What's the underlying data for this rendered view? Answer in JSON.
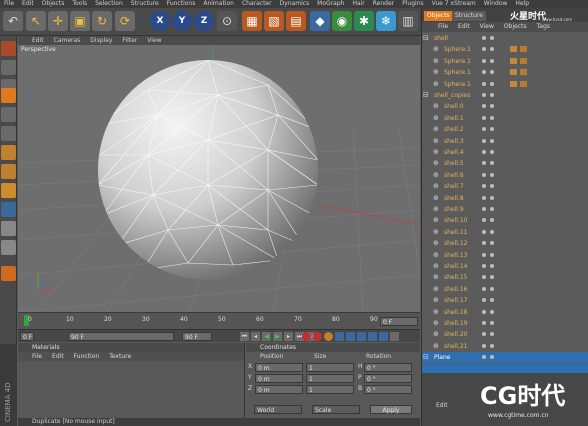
{
  "menubar": {
    "items": [
      "File",
      "Edit",
      "Objects",
      "Tools",
      "Selection",
      "Structure",
      "Functions",
      "Animation",
      "Character",
      "Dynamics",
      "MoGraph",
      "Hair",
      "Render",
      "Plugins",
      "Vue 7 xStream",
      "Window",
      "Help"
    ]
  },
  "toolbar": {
    "xyz": [
      "X",
      "Y",
      "Z"
    ]
  },
  "viewport": {
    "menu": [
      "Edit",
      "Cameras",
      "Display",
      "Filter",
      "View"
    ],
    "label": "Perspective"
  },
  "timeline": {
    "ticks": [
      "0",
      "10",
      "20",
      "30",
      "40",
      "50",
      "60",
      "70",
      "80",
      "90"
    ],
    "end_label": "0 F"
  },
  "transport": {
    "start": "0 F",
    "field2": "90 F",
    "field3": "90 F"
  },
  "materials": {
    "title": "Materials",
    "menu": [
      "File",
      "Edit",
      "Function",
      "Texture"
    ]
  },
  "coordinates": {
    "title": "Coordinates",
    "columns": [
      "Position",
      "Size",
      "Rotation"
    ],
    "rows": [
      {
        "axis": "X",
        "pos": "0 m",
        "size": "1",
        "rot_axis": "H",
        "rot": "0 °"
      },
      {
        "axis": "Y",
        "pos": "0 m",
        "size": "1",
        "rot_axis": "P",
        "rot": "0 °"
      },
      {
        "axis": "Z",
        "pos": "0 m",
        "size": "1",
        "rot_axis": "B",
        "rot": "0 °"
      }
    ],
    "mode1": "World",
    "mode2": "Scale",
    "apply": "Apply"
  },
  "statusbar": {
    "text": "Duplicate [No mouse input]"
  },
  "brand_vertical": "CINEMA 4D",
  "object_panel": {
    "tabs": [
      "Objects",
      "Structure"
    ],
    "menu": [
      "File",
      "Edit",
      "View",
      "Objects",
      "Tags"
    ],
    "rows": [
      {
        "name": "shell",
        "level": 0
      },
      {
        "name": "Sphere.1",
        "level": 1
      },
      {
        "name": "Sphere.1",
        "level": 1
      },
      {
        "name": "Sphere.1",
        "level": 1
      },
      {
        "name": "Sphere.1",
        "level": 1
      },
      {
        "name": "shell_copies",
        "level": 0
      },
      {
        "name": "shell.0",
        "level": 1
      },
      {
        "name": "shell.1",
        "level": 1
      },
      {
        "name": "shell.2",
        "level": 1
      },
      {
        "name": "shell.3",
        "level": 1
      },
      {
        "name": "shell.4",
        "level": 1
      },
      {
        "name": "shell.5",
        "level": 1
      },
      {
        "name": "shell.6",
        "level": 1
      },
      {
        "name": "shell.7",
        "level": 1
      },
      {
        "name": "shell.8",
        "level": 1
      },
      {
        "name": "shell.9",
        "level": 1
      },
      {
        "name": "shell.10",
        "level": 1
      },
      {
        "name": "shell.11",
        "level": 1
      },
      {
        "name": "shell.12",
        "level": 1
      },
      {
        "name": "shell.13",
        "level": 1
      },
      {
        "name": "shell.14",
        "level": 1
      },
      {
        "name": "shell.15",
        "level": 1
      },
      {
        "name": "shell.16",
        "level": 1
      },
      {
        "name": "shell.17",
        "level": 1
      },
      {
        "name": "shell.18",
        "level": 1
      },
      {
        "name": "shell.19",
        "level": 1
      },
      {
        "name": "shell.20",
        "level": 1
      },
      {
        "name": "shell.21",
        "level": 1
      },
      {
        "name": "Plane",
        "level": 0
      }
    ],
    "attrib_menu": [
      "Edit"
    ]
  },
  "watermark": {
    "top": "火星时代",
    "top_url": "www.hxsd.com",
    "bottom": "CG时代",
    "bottom_url": "www.cgtime.com.cn"
  },
  "colors": {
    "accent": "#e2b35a",
    "selected_row": "#2e6fb0",
    "viewport_bg": "#6e6e6e"
  }
}
